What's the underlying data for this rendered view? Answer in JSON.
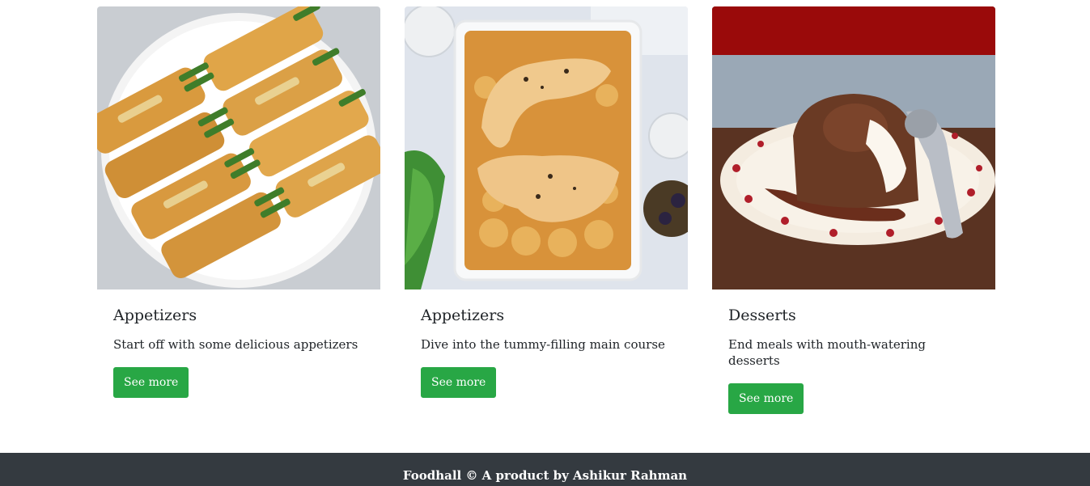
{
  "cards": [
    {
      "title": "Appetizers",
      "text": "Start off with some delicious appetizers",
      "button_label": "See more",
      "image_alt": "asparagus puff pastry appetizers on a white plate"
    },
    {
      "title": "Appetizers",
      "text": "Dive into the tummy-filling main course",
      "button_label": "See more",
      "image_alt": "roast chicken legs over potatoes in a baking dish"
    },
    {
      "title": "Desserts",
      "text": "End meals with mouth-watering desserts",
      "button_label": "See more",
      "image_alt": "chocolate lava cake with cream on a spotted plate"
    }
  ],
  "footer": {
    "text": "Foodhall © A product by Ashikur Rahman"
  },
  "colors": {
    "button": "#28a745",
    "footer_bg": "#343a40",
    "footer_text": "#ffffff"
  }
}
